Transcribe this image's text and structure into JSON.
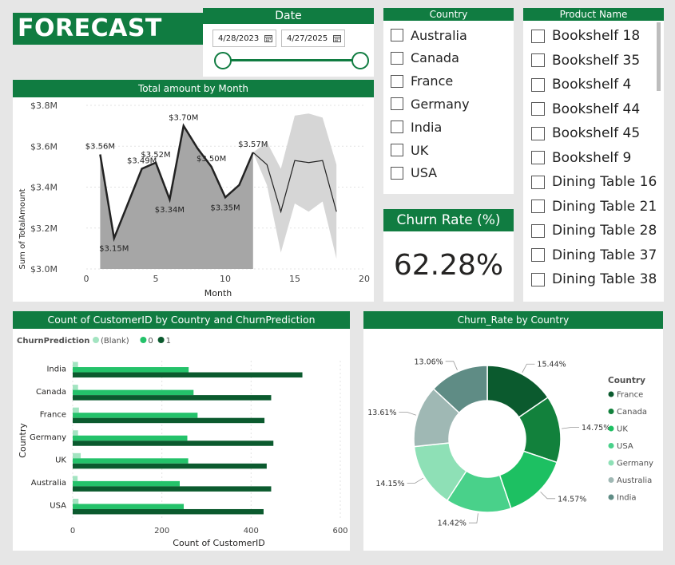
{
  "title": "FORECAST",
  "date_slicer": {
    "header": "Date",
    "start": "4/28/2023",
    "end": "4/27/2025",
    "icon": "calendar-icon"
  },
  "country_slicer": {
    "header": "Country",
    "items": [
      "Australia",
      "Canada",
      "France",
      "Germany",
      "India",
      "UK",
      "USA"
    ]
  },
  "product_slicer": {
    "header": "Product Name",
    "items": [
      "Bookshelf 18",
      "Bookshelf 35",
      "Bookshelf 4",
      "Bookshelf 44",
      "Bookshelf 45",
      "Bookshelf 9",
      "Dining Table 16",
      "Dining Table 21",
      "Dining Table 28",
      "Dining Table 37",
      "Dining Table 38"
    ]
  },
  "churn_card": {
    "header": "Churn Rate (%)",
    "value": "62.28%"
  },
  "colors": {
    "brand_green": "#107c41",
    "dark_green": "#0b5a2e",
    "light_green": "#4fd28a",
    "area_fill": "#a6a6a6",
    "forecast_band": "#d6d6d6"
  },
  "chart_data": [
    {
      "type": "area",
      "title": "Total amount by Month",
      "xlabel": "Month",
      "ylabel": "Sum of TotalAmount",
      "xlim": [
        0,
        20
      ],
      "ylim": [
        3.0,
        3.8
      ],
      "x_ticks": [
        "0",
        "5",
        "10",
        "15",
        "20"
      ],
      "y_ticks": [
        "$3.0M",
        "$3.2M",
        "$3.4M",
        "$3.6M",
        "$3.8M"
      ],
      "actual": {
        "x": [
          1,
          2,
          3,
          4,
          5,
          6,
          7,
          8,
          9,
          10,
          11,
          12
        ],
        "y": [
          3.56,
          3.15,
          3.32,
          3.49,
          3.52,
          3.34,
          3.7,
          3.59,
          3.5,
          3.35,
          3.41,
          3.57
        ],
        "labels": [
          "$3.56M",
          "$3.15M",
          "",
          "$3.49M",
          "$3.52M",
          "$3.34M",
          "$3.70M",
          "",
          "$3.50M",
          "$3.35M",
          "",
          "$3.57M"
        ]
      },
      "forecast": {
        "x": [
          12,
          13,
          14,
          15,
          16,
          17,
          18
        ],
        "y": [
          3.57,
          3.51,
          3.28,
          3.53,
          3.52,
          3.53,
          3.28
        ],
        "lower": [
          3.57,
          3.41,
          3.08,
          3.32,
          3.28,
          3.33,
          3.05
        ],
        "upper": [
          3.57,
          3.62,
          3.49,
          3.75,
          3.76,
          3.74,
          3.51
        ]
      },
      "grid": true
    },
    {
      "type": "bar",
      "orientation": "horizontal",
      "title": "Count of CustomerID by Country and ChurnPrediction",
      "legend_title": "ChurnPrediction",
      "xlabel": "Count of CustomerID",
      "ylabel": "Country",
      "xlim": [
        0,
        600
      ],
      "x_ticks": [
        "0",
        "200",
        "400",
        "600"
      ],
      "categories": [
        "India",
        "Canada",
        "France",
        "Germany",
        "UK",
        "Australia",
        "USA"
      ],
      "series": [
        {
          "name": "(Blank)",
          "color": "#a3e4c1",
          "values": [
            12,
            12,
            14,
            12,
            18,
            11,
            13
          ]
        },
        {
          "name": "0",
          "color": "#24c26a",
          "values": [
            260,
            271,
            280,
            257,
            259,
            240,
            249
          ]
        },
        {
          "name": "1",
          "color": "#0b5a2e",
          "values": [
            515,
            445,
            430,
            450,
            435,
            445,
            428
          ]
        }
      ],
      "grid": true
    },
    {
      "type": "pie",
      "title": "Churn_Rate by Country",
      "legend_title": "Country",
      "legend_position": "right",
      "slices": [
        {
          "name": "France",
          "value": 15.44,
          "label": "15.44%",
          "color": "#0b5a2e"
        },
        {
          "name": "Canada",
          "value": 14.75,
          "label": "14.75%",
          "color": "#12813c"
        },
        {
          "name": "UK",
          "value": 14.57,
          "label": "14.57%",
          "color": "#1dc062"
        },
        {
          "name": "USA",
          "value": 14.42,
          "label": "14.42%",
          "color": "#49d18a"
        },
        {
          "name": "Germany",
          "value": 14.15,
          "label": "14.15%",
          "color": "#8ee0b6"
        },
        {
          "name": "Australia",
          "value": 13.61,
          "label": "13.61%",
          "color": "#9fb8b4"
        },
        {
          "name": "India",
          "value": 13.06,
          "label": "13.06%",
          "color": "#5f8c85"
        }
      ]
    }
  ]
}
